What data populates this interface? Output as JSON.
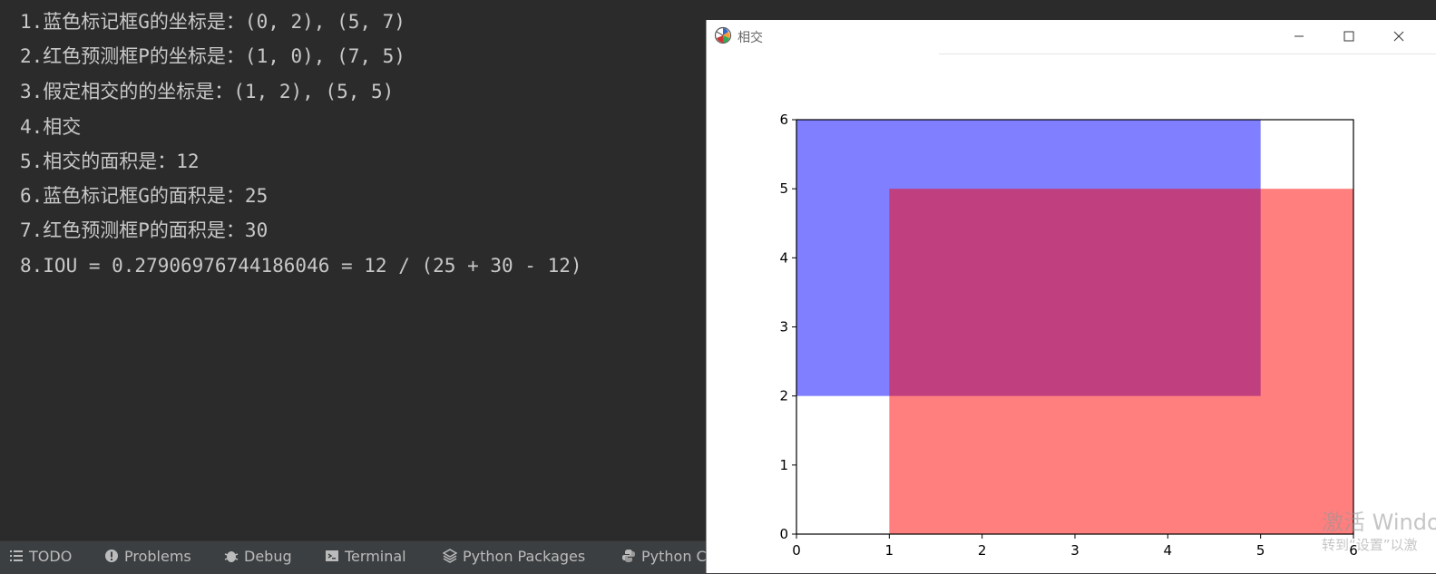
{
  "console": {
    "lines": [
      "1.蓝色标记框G的坐标是：(0, 2), (5, 7)",
      "2.红色预测框P的坐标是：(1, 0), (7, 5)",
      "3.假定相交的的坐标是：(1, 2), (5, 5)",
      "4.相交",
      "5.相交的面积是：12",
      "6.蓝色标记框G的面积是：25",
      "7.红色预测框P的面积是：30",
      "8.IOU = 0.27906976744186046 = 12 / (25 + 30 - 12)"
    ]
  },
  "statusbar": {
    "items": [
      {
        "label": "TODO",
        "icon": "list-icon"
      },
      {
        "label": "Problems",
        "icon": "problems-icon"
      },
      {
        "label": "Debug",
        "icon": "bug-icon"
      },
      {
        "label": "Terminal",
        "icon": "terminal-icon"
      },
      {
        "label": "Python Packages",
        "icon": "layers-icon"
      },
      {
        "label": "Python C",
        "icon": "python-icon"
      }
    ]
  },
  "window": {
    "title": "相交",
    "controls": [
      "minimize-icon",
      "maximize-icon",
      "close-icon"
    ]
  },
  "watermark": {
    "line1": "激活 Windo",
    "line2": "转到“设置”以激"
  },
  "chart_data": {
    "type": "area",
    "xlim": [
      0,
      6
    ],
    "ylim": [
      0,
      6
    ],
    "xticks": [
      "0",
      "1",
      "2",
      "3",
      "4",
      "5",
      "6"
    ],
    "yticks": [
      "0",
      "1",
      "2",
      "3",
      "4",
      "5",
      "6"
    ],
    "grid": false,
    "rectangles": [
      {
        "x0": 0,
        "y0": 2,
        "x1": 5,
        "y1": 7,
        "color": "#0000ff",
        "alpha": 0.5
      },
      {
        "x0": 1,
        "y0": 0,
        "x1": 7,
        "y1": 5,
        "color": "#ff0000",
        "alpha": 0.5
      }
    ]
  }
}
